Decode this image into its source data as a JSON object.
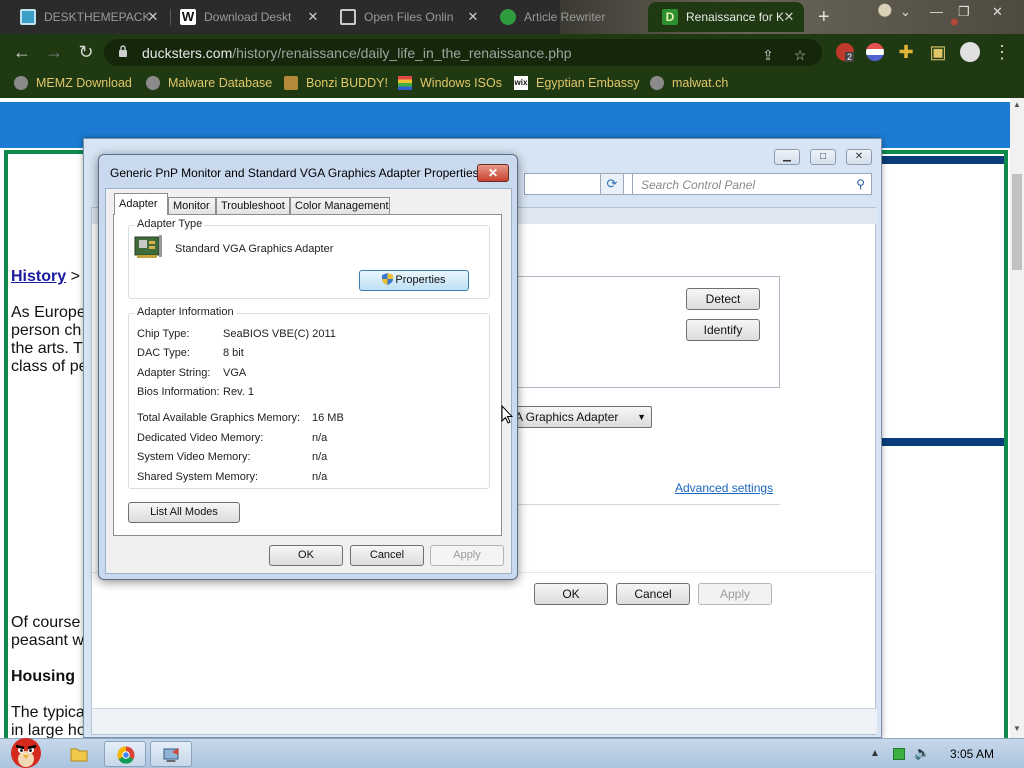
{
  "browser": {
    "tabs": [
      {
        "title": "DESKTHEMEPACK",
        "favicon_color": "#3aa0c8",
        "active": false
      },
      {
        "title": "Download Deskt",
        "favicon_color": "#ffffff",
        "active": false
      },
      {
        "title": "Open Files Onlin",
        "favicon_color": "#c9c9c9",
        "active": false
      },
      {
        "title": "Article Rewriter",
        "favicon_color": "#2e9c3f",
        "active": false
      },
      {
        "title": "Renaissance for K",
        "favicon_color": "#2f8f2f",
        "active": true
      }
    ],
    "url_domain": "ducksters.com",
    "url_path": "/history/renaissance/daily_life_in_the_renaissance.php",
    "extension_badge": "2",
    "bookmarks": [
      {
        "label": "MEMZ Download",
        "icon_color": "#8a8a8a"
      },
      {
        "label": "Malware Database",
        "icon_color": "#8a8a8a"
      },
      {
        "label": "Bonzi BUDDY!",
        "icon_color": "#b5893a"
      },
      {
        "label": "Windows ISOs",
        "icon_color": "#e04848"
      },
      {
        "label": "Egyptian Embassy",
        "icon_color": "#ffffff"
      },
      {
        "label": "malwat.ch",
        "icon_color": "#8a8a8a"
      }
    ]
  },
  "page": {
    "history_link": "History",
    "breadcrumb_sep": ">",
    "para1": [
      "As Europe",
      "person ch",
      "the arts. T",
      "class of pe"
    ],
    "para2": [
      "Of course",
      "peasant w"
    ],
    "heading_housing": "Housing",
    "para3": [
      "The typica",
      "in large ho"
    ]
  },
  "back_window": {
    "search_placeholder": "Search Control Panel",
    "detect_label": "Detect",
    "identify_label": "Identify",
    "display_combo": "A Graphics Adapter",
    "advanced_link": "Advanced settings",
    "ok_label": "OK",
    "cancel_label": "Cancel",
    "apply_label": "Apply"
  },
  "dialog": {
    "title": "Generic PnP Monitor and Standard VGA Graphics Adapter Properties",
    "close_label": "✕",
    "tabs": [
      "Adapter",
      "Monitor",
      "Troubleshoot",
      "Color Management"
    ],
    "adapter_type_legend": "Adapter Type",
    "adapter_name": "Standard VGA Graphics Adapter",
    "properties_label": "Properties",
    "adapter_info_legend": "Adapter Information",
    "info": [
      {
        "label": "Chip Type:",
        "value": "SeaBIOS VBE(C) 2011"
      },
      {
        "label": "DAC Type:",
        "value": "8 bit"
      },
      {
        "label": "Adapter String:",
        "value": "VGA"
      },
      {
        "label": "Bios Information:",
        "value": "Rev. 1"
      }
    ],
    "memory": [
      {
        "label": "Total Available Graphics Memory:",
        "value": "16 MB"
      },
      {
        "label": "Dedicated Video Memory:",
        "value": "n/a"
      },
      {
        "label": "System Video Memory:",
        "value": "n/a"
      },
      {
        "label": "Shared System Memory:",
        "value": "n/a"
      }
    ],
    "list_all_modes_label": "List All Modes",
    "ok_label": "OK",
    "cancel_label": "Cancel",
    "apply_label": "Apply"
  },
  "taskbar": {
    "clock": "3:05 AM"
  }
}
